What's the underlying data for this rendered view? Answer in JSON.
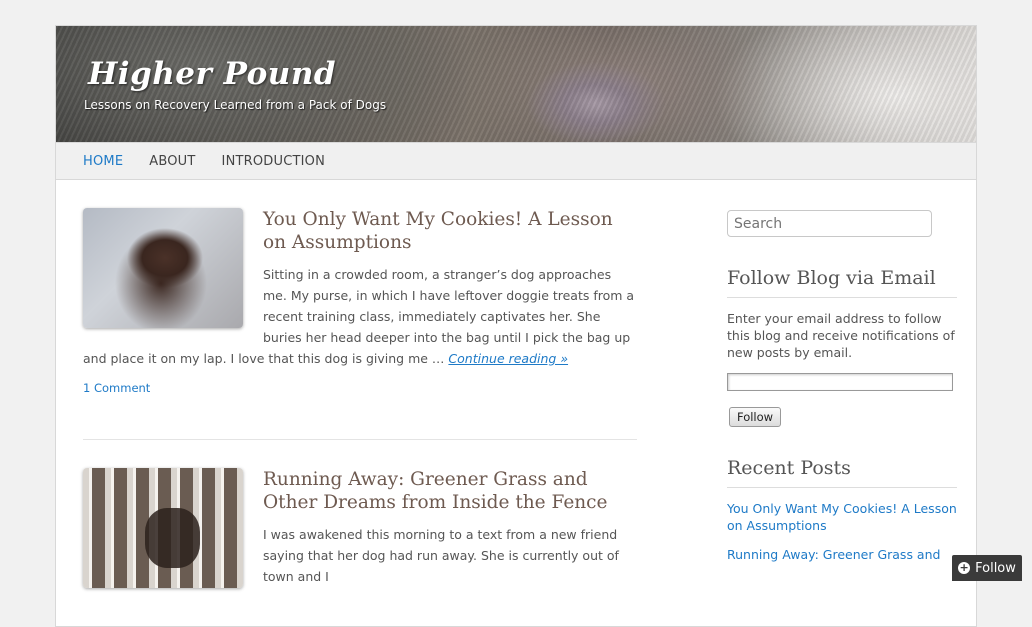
{
  "header": {
    "title": "Higher Pound",
    "description": "Lessons on Recovery Learned from a Pack of Dogs"
  },
  "nav": {
    "items": [
      {
        "label": "HOME",
        "active": true
      },
      {
        "label": "ABOUT",
        "active": false
      },
      {
        "label": "INTRODUCTION",
        "active": false
      }
    ]
  },
  "posts": [
    {
      "title": "You Only Want My Cookies! A Lesson on Assumptions",
      "excerpt": "Sitting in a crowded room, a stranger’s dog approaches me. My purse, in which I have leftover doggie treats from a recent training class, immediately captivates her. She buries her head deeper into the bag until I pick the bag up and place it on my lap. I love that this dog is giving me …",
      "more_label": "Continue reading »",
      "comments": "1 Comment"
    },
    {
      "title": "Running Away: Greener Grass and Other Dreams from Inside the Fence",
      "excerpt": "I was awakened this morning to a text from a new friend saying that her dog had run away. She is currently out of town and I"
    }
  ],
  "sidebar": {
    "search_placeholder": "Search",
    "follow_title": "Follow Blog via Email",
    "follow_text": "Enter your email address to follow this blog and receive notifications of new posts by email.",
    "follow_button": "Follow",
    "recent_title": "Recent Posts",
    "recent_posts": [
      "You Only Want My Cookies! A Lesson on Assumptions",
      "Running Away: Greener Grass and"
    ]
  },
  "floating_follow": {
    "label": "Follow",
    "icon": "plus-circle-icon"
  },
  "colors": {
    "link": "#1e7ac7",
    "post_title": "#6e5a50",
    "floating_bg": "#3a3a3a"
  }
}
